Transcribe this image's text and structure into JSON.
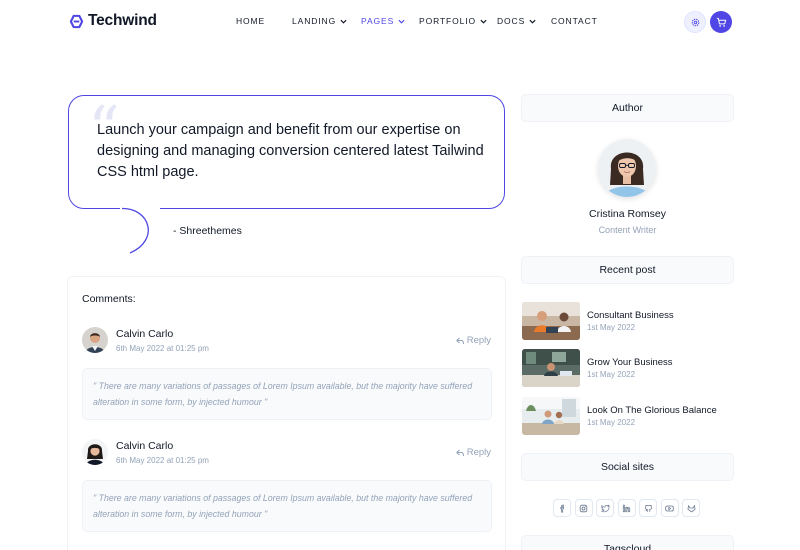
{
  "brand": {
    "name": "Techwind"
  },
  "nav": {
    "items": [
      {
        "label": "HOME",
        "has_dropdown": false,
        "active": false
      },
      {
        "label": "LANDING",
        "has_dropdown": true,
        "active": false
      },
      {
        "label": "PAGES",
        "has_dropdown": true,
        "active": true
      },
      {
        "label": "PORTFOLIO",
        "has_dropdown": true,
        "active": false
      },
      {
        "label": "DOCS",
        "has_dropdown": true,
        "active": false
      },
      {
        "label": "CONTACT",
        "has_dropdown": false,
        "active": false
      }
    ],
    "settings_icon": "gear-icon",
    "cart_icon": "cart-icon"
  },
  "quote": {
    "text": "Launch your campaign and benefit from our expertise on designing and managing conversion centered latest Tailwind CSS html page.",
    "author": "- Shreethemes"
  },
  "comments": {
    "title": "Comments:",
    "items": [
      {
        "name": "Calvin Carlo",
        "date": "6th May 2022 at 01:25 pm",
        "reply_label": "Reply",
        "text": "\" There are many variations of passages of Lorem Ipsum available, but the majority have suffered alteration in some form, by injected humour \""
      },
      {
        "name": "Calvin Carlo",
        "date": "6th May 2022 at 01:25 pm",
        "reply_label": "Reply",
        "text": "\" There are many variations of passages of Lorem Ipsum available, but the majority have suffered alteration in some form, by injected humour \""
      }
    ]
  },
  "sidebar": {
    "author": {
      "heading": "Author",
      "name": "Cristina Romsey",
      "role": "Content Writer"
    },
    "recent": {
      "heading": "Recent post",
      "posts": [
        {
          "title": "Consultant Business",
          "date": "1st May 2022"
        },
        {
          "title": "Grow Your Business",
          "date": "1st May 2022"
        },
        {
          "title": "Look On The Glorious Balance",
          "date": "1st May 2022"
        }
      ]
    },
    "social": {
      "heading": "Social sites",
      "icons": [
        "facebook-icon",
        "instagram-icon",
        "twitter-icon",
        "linkedin-icon",
        "github-icon",
        "youtube-icon",
        "gitlab-icon"
      ]
    },
    "tags": {
      "heading": "Tagscloud"
    }
  },
  "colors": {
    "accent": "#4f46e5",
    "muted": "#94a3b8",
    "panel": "#f8fafc"
  }
}
